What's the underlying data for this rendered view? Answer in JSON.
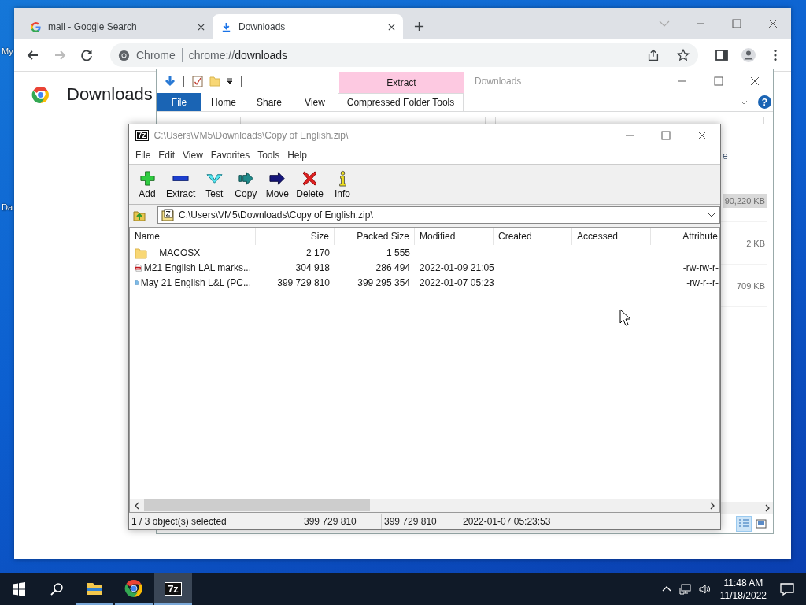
{
  "desktop": {
    "icon_labels": [
      "My",
      "Da"
    ]
  },
  "chrome": {
    "tabs": [
      {
        "title": "mail - Google Search",
        "kind": "google",
        "selected": false
      },
      {
        "title": "Downloads",
        "kind": "downloads",
        "selected": true
      }
    ],
    "omnibox": {
      "chip": "Chrome",
      "scheme": "chrome://",
      "host": "downloads"
    },
    "page_title": "Downloads"
  },
  "explorer": {
    "title": "Downloads",
    "context_tab": "Extract",
    "help_label": "?",
    "ribbon_tabs": [
      {
        "label": "File",
        "kind": "file"
      },
      {
        "label": "Home",
        "kind": "tab"
      },
      {
        "label": "Share",
        "kind": "tab"
      },
      {
        "label": "View",
        "kind": "tab"
      },
      {
        "label": "Compressed Folder Tools",
        "kind": "context"
      }
    ],
    "column_header": "e",
    "sizes": [
      {
        "text": "90,220 KB",
        "selected": true
      },
      {
        "text": "2 KB",
        "selected": false
      },
      {
        "text": "709 KB",
        "selected": false
      }
    ]
  },
  "sevenzip": {
    "logo": "7z",
    "title": "C:\\Users\\VM5\\Downloads\\Copy of English.zip\\",
    "menu": [
      "File",
      "Edit",
      "View",
      "Favorites",
      "Tools",
      "Help"
    ],
    "toolbar": [
      {
        "label": "Add",
        "kind": "add"
      },
      {
        "label": "Extract",
        "kind": "extract"
      },
      {
        "label": "Test",
        "kind": "test"
      },
      {
        "label": "Copy",
        "kind": "copy"
      },
      {
        "label": "Move",
        "kind": "move"
      },
      {
        "label": "Delete",
        "kind": "delete"
      },
      {
        "label": "Info",
        "kind": "info"
      }
    ],
    "path": "C:\\Users\\VM5\\Downloads\\Copy of English.zip\\",
    "columns": [
      "Name",
      "Size",
      "Packed Size",
      "Modified",
      "Created",
      "Accessed",
      "Attribute"
    ],
    "rows": [
      {
        "kind": "folder",
        "name": "__MACOSX",
        "size": "2 170",
        "packed_size": "1 555"
      },
      {
        "kind": "pdf",
        "name": "M21 English LAL marks...",
        "size": "304 918",
        "packed_size": "286 494",
        "modified": "2022-01-09 21:05",
        "attributes": "-rw-rw-r-"
      },
      {
        "kind": "file",
        "name": "May 21 English L&L (PC...",
        "size": "399 729 810",
        "packed_size": "399 295 354",
        "modified": "2022-01-07 05:23",
        "attributes": "-rw-r--r-"
      }
    ],
    "status": [
      "1 / 3 object(s) selected",
      "399 729 810",
      "399 729 810",
      "2022-01-07 05:23:53"
    ]
  },
  "taskbar": {
    "apps": [
      {
        "kind": "explorer",
        "selected": false
      },
      {
        "kind": "chrome",
        "selected": false
      },
      {
        "kind": "sevenzip",
        "label": "7z",
        "selected": true
      }
    ],
    "time": "11:48 AM",
    "date": "11/18/2022"
  }
}
